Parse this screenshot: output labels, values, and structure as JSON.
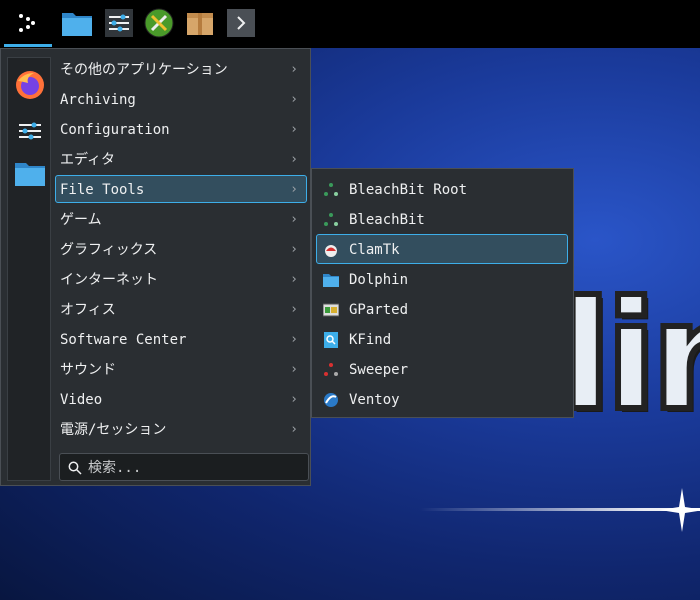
{
  "taskbar": {
    "buttons": [
      {
        "name": "application-launcher-icon"
      },
      {
        "name": "file-manager-icon"
      },
      {
        "name": "system-settings-icon"
      },
      {
        "name": "system-tools-icon"
      },
      {
        "name": "package-installer-icon"
      },
      {
        "name": "expand-arrow-icon"
      }
    ]
  },
  "favorites": [
    "firefox-icon",
    "settings-icon",
    "folder-icon"
  ],
  "categories": [
    {
      "label": "その他のアプリケーション",
      "selected": false
    },
    {
      "label": "Archiving",
      "selected": false
    },
    {
      "label": "Configuration",
      "selected": false
    },
    {
      "label": "エディタ",
      "selected": false
    },
    {
      "label": "File Tools",
      "selected": true
    },
    {
      "label": "ゲーム",
      "selected": false
    },
    {
      "label": "グラフィックス",
      "selected": false
    },
    {
      "label": "インターネット",
      "selected": false
    },
    {
      "label": "オフィス",
      "selected": false
    },
    {
      "label": "Software Center",
      "selected": false
    },
    {
      "label": "サウンド",
      "selected": false
    },
    {
      "label": "Video",
      "selected": false
    },
    {
      "label": "電源/セッション",
      "selected": false
    }
  ],
  "arrow_glyph": "›",
  "search": {
    "placeholder": "検索...",
    "value": ""
  },
  "submenu": {
    "items": [
      {
        "label": "BleachBit Root",
        "icon": "bleachbit-icon",
        "selected": false
      },
      {
        "label": "BleachBit",
        "icon": "bleachbit-icon",
        "selected": false
      },
      {
        "label": "ClamTk",
        "icon": "clamtk-icon",
        "selected": true
      },
      {
        "label": "Dolphin",
        "icon": "folder-icon",
        "selected": false
      },
      {
        "label": "GParted",
        "icon": "gparted-icon",
        "selected": false
      },
      {
        "label": "KFind",
        "icon": "kfind-icon",
        "selected": false
      },
      {
        "label": "Sweeper",
        "icon": "sweeper-icon",
        "selected": false
      },
      {
        "label": "Ventoy",
        "icon": "ventoy-icon",
        "selected": false
      }
    ]
  },
  "wallpaper": {
    "logo_text": "lin"
  },
  "colors": {
    "accent": "#3daee9",
    "menu_bg": "#2a2e32",
    "selection_bg": "#334e5e"
  }
}
